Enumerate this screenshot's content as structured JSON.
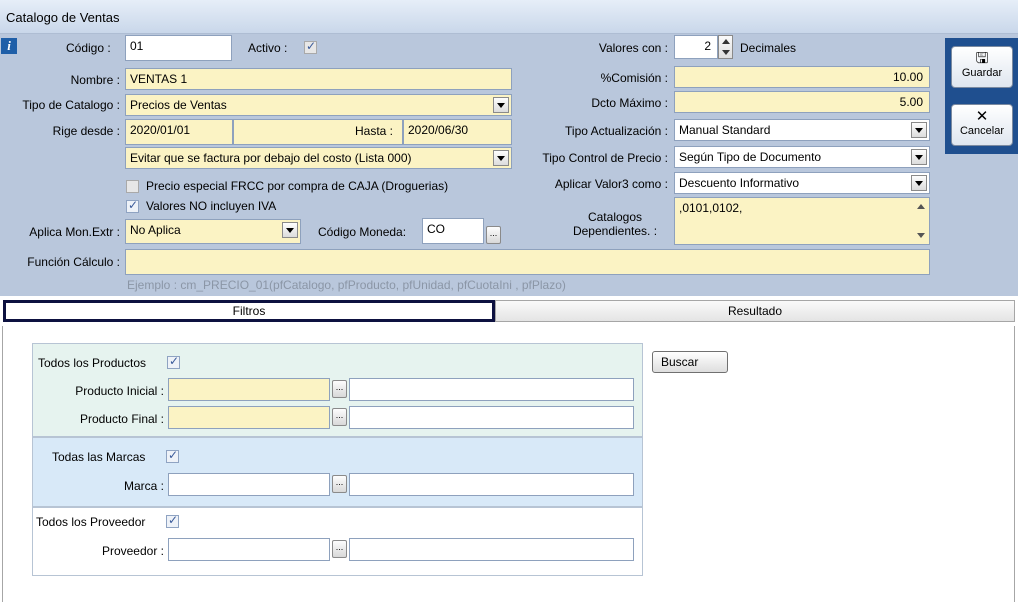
{
  "window": {
    "title": "Catalogo de Ventas"
  },
  "header": {
    "codigo_label": "Código :",
    "codigo_value": "01",
    "activo_label": "Activo :",
    "nombre_label": "Nombre :",
    "nombre_value": "VENTAS 1",
    "tipo_catalogo_label": "Tipo de Catalogo :",
    "tipo_catalogo_value": "Precios de Ventas",
    "rige_desde_label": "Rige desde :",
    "rige_desde_value": "2020/01/01",
    "hasta_label": "Hasta :",
    "hasta_value": "2020/06/30",
    "costo_option_value": "Evitar que se factura por debajo del costo (Lista 000)",
    "precio_especial_label": "Precio especial FRCC por compra de CAJA (Droguerias)",
    "valores_iva_label": "Valores NO incluyen IVA",
    "aplica_mon_label": "Aplica Mon.Extr :",
    "aplica_mon_value": "No Aplica",
    "codigo_moneda_label": "Código Moneda:",
    "codigo_moneda_value": "CO",
    "funcion_calculo_label": "Función Cálculo :",
    "funcion_calculo_value": "",
    "funcion_hint": "Ejemplo : cm_PRECIO_01(pfCatalogo, pfProducto, pfUnidad, pfCuotaIni , pfPlazo)",
    "valores_con_label": "Valores con :",
    "valores_con_value": "2",
    "decimales_label": "Decimales",
    "comision_label": "%Comisión :",
    "comision_value": "10.00",
    "dcto_maximo_label": "Dcto Máximo :",
    "dcto_maximo_value": "5.00",
    "tipo_actualizacion_label": "Tipo Actualización :",
    "tipo_actualizacion_value": "Manual Standard",
    "tipo_control_label": "Tipo Control de Precio :",
    "tipo_control_value": "Según Tipo de Documento",
    "aplicar_valor3_label": "Aplicar Valor3 como :",
    "aplicar_valor3_value": "Descuento Informativo",
    "catalogos_dep_label_1": "Catalogos",
    "catalogos_dep_label_2": "Dependientes. :",
    "catalogos_dep_value": ",0101,0102,"
  },
  "side": {
    "guardar": "Guardar",
    "cancelar": "Cancelar"
  },
  "tabs": [
    {
      "label": "Filtros"
    },
    {
      "label": "Resultado"
    }
  ],
  "filtros": {
    "todos_productos": "Todos los Productos",
    "producto_inicial": "Producto Inicial :",
    "producto_final": "Producto Final :",
    "todas_marcas": "Todas las Marcas",
    "marca": "Marca :",
    "todos_proveedor": "Todos los Proveedor",
    "proveedor": "Proveedor :",
    "buscar": "Buscar"
  },
  "colors": {
    "header_bg": "#b9c7dc",
    "field_bg": "#fbf3c4",
    "side_panel": "#1f4f8f",
    "active_tab_border": "#0d1140"
  }
}
